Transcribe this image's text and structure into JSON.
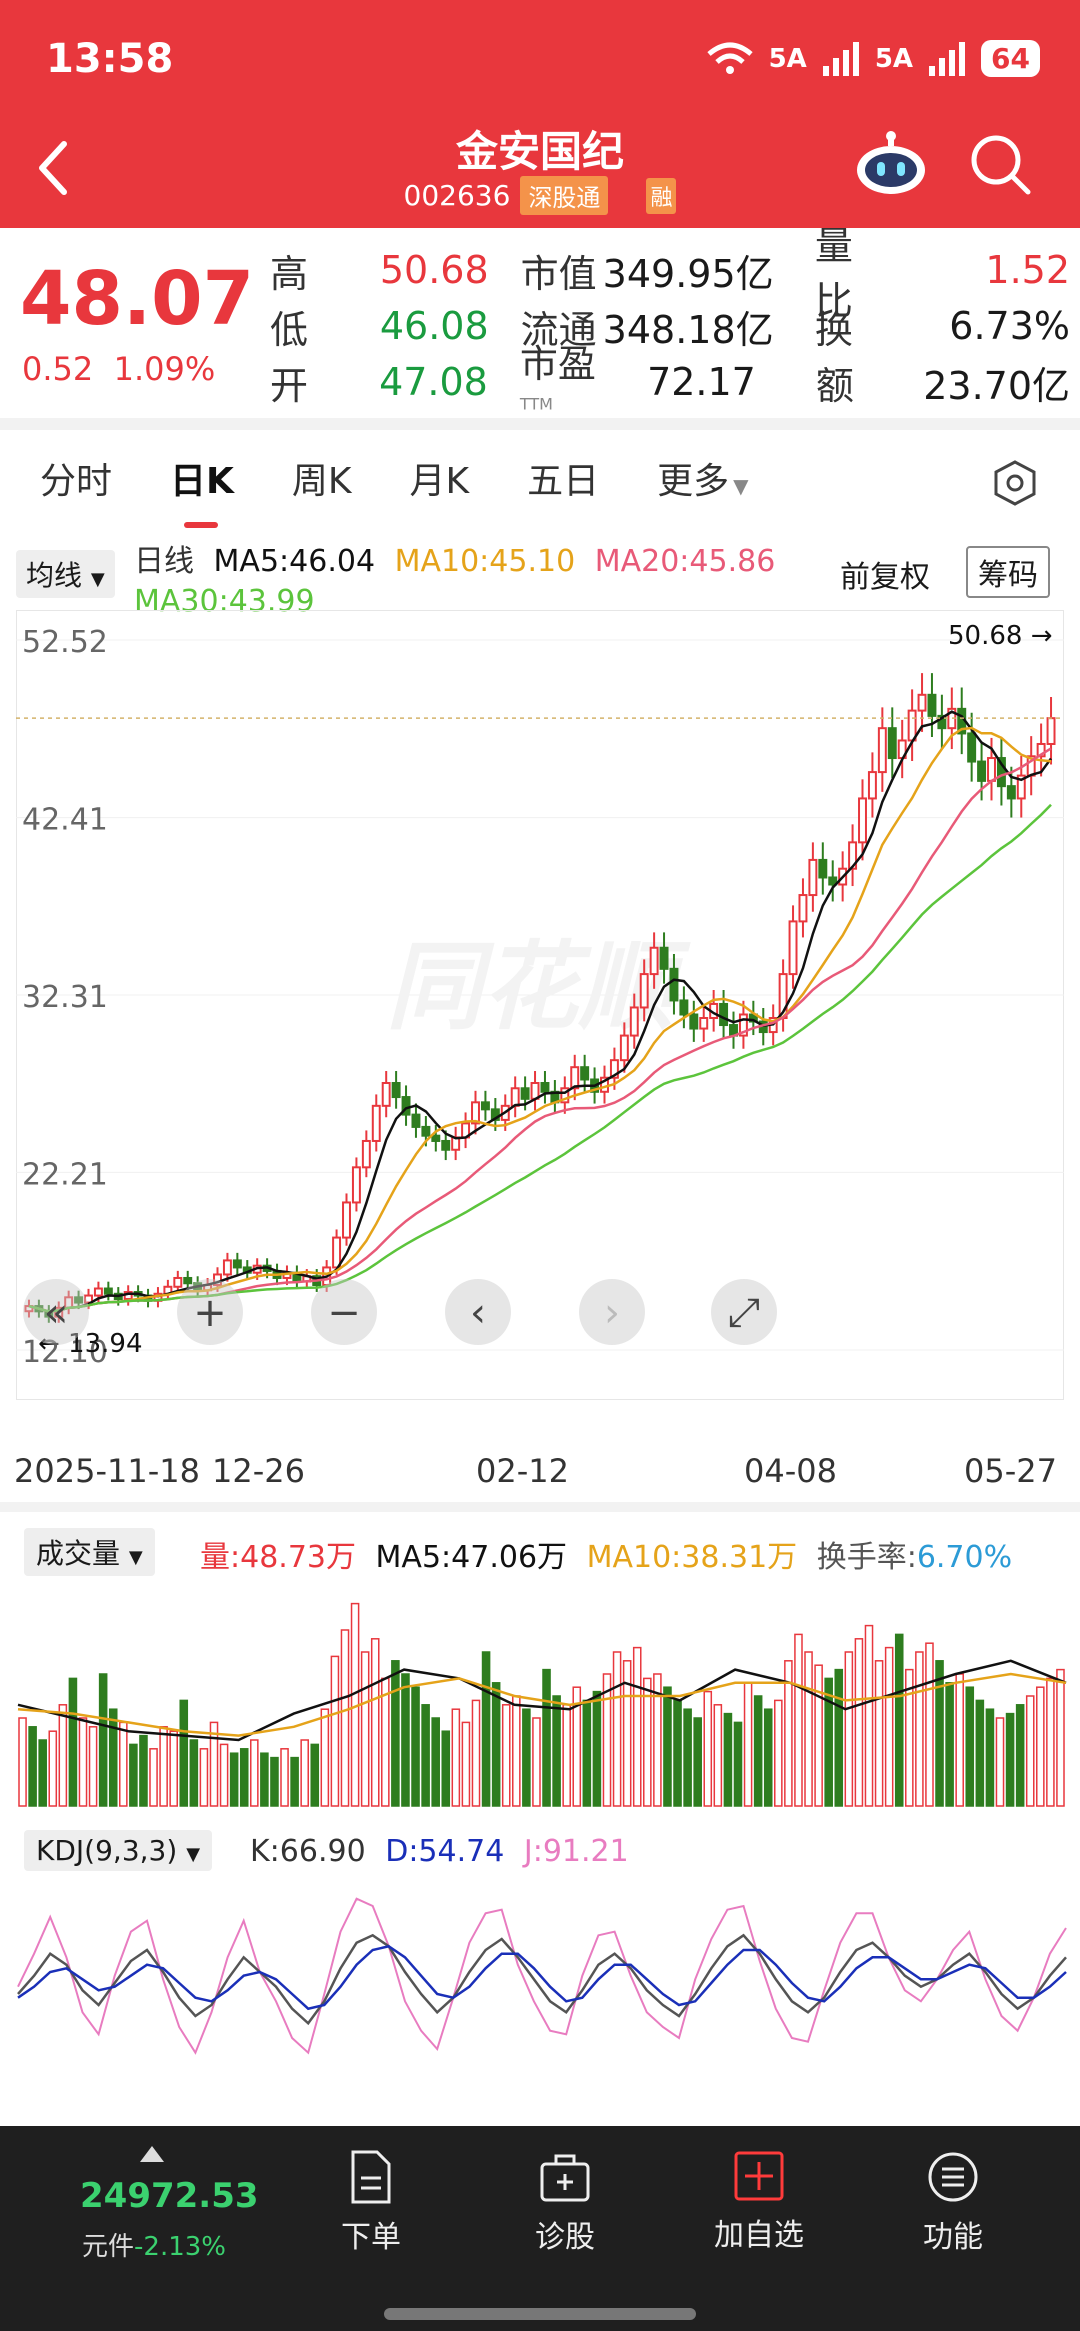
{
  "status": {
    "time": "13:58",
    "signal1": "5A",
    "signal2": "5A",
    "battery": "64"
  },
  "header": {
    "title": "金安国纪",
    "code": "002636",
    "tag": "深股通",
    "tag2": "融"
  },
  "quote": {
    "price": "48.07",
    "change": "0.52",
    "change_pct": "1.09%",
    "rows": [
      {
        "l1": "高",
        "v1": "50.68",
        "l2": "市值",
        "v2": "349.95亿",
        "l3": "量比",
        "v3": "1.52"
      },
      {
        "l1": "低",
        "v1": "46.08",
        "l2": "流通",
        "v2": "348.18亿",
        "l3": "换",
        "v3": "6.73%"
      },
      {
        "l1": "开",
        "v1": "47.08",
        "l2": "市盈",
        "l2sup": "TTM",
        "v2": "72.17",
        "l3": "额",
        "v3": "23.70亿"
      }
    ]
  },
  "tabs": [
    "分时",
    "日K",
    "周K",
    "月K",
    "五日",
    "更多"
  ],
  "ma": {
    "selector": "均线",
    "label": "日线",
    "ma5": "MA5:46.04",
    "ma10": "MA10:45.10",
    "ma20": "MA20:45.86",
    "ma30": "MA30:43.99",
    "fq": "前复权",
    "cm": "筹码"
  },
  "chart_data": {
    "type": "candlestick",
    "y_ticks": [
      "52.52",
      "42.41",
      "32.31",
      "22.21",
      "12.10"
    ],
    "ylim": [
      12.1,
      52.52
    ],
    "high_label": "50.68",
    "low_label": "13.94",
    "watermark": "同花顺",
    "x_labels": [
      "2025-11-18",
      "12-26",
      "02-12",
      "04-08",
      "05-27"
    ],
    "colors": {
      "up": "#e8373d",
      "down": "#2e7d1f",
      "ma5": "#111111",
      "ma10": "#e5a31a",
      "ma20": "#e85a78",
      "ma30": "#5cc43c"
    },
    "close_series": [
      14.6,
      14.3,
      14.0,
      14.5,
      15.1,
      14.8,
      15.2,
      15.6,
      15.3,
      15.0,
      15.4,
      15.2,
      14.9,
      15.3,
      15.7,
      16.2,
      15.9,
      15.5,
      15.8,
      16.4,
      17.2,
      16.8,
      16.5,
      16.9,
      16.6,
      16.2,
      16.5,
      16.0,
      16.3,
      15.8,
      16.8,
      18.5,
      20.5,
      22.5,
      24.0,
      26.0,
      27.3,
      26.5,
      25.5,
      24.8,
      24.3,
      24.0,
      23.5,
      24.2,
      25.0,
      26.2,
      25.8,
      25.2,
      26.0,
      27.0,
      26.4,
      27.3,
      26.8,
      26.2,
      27.0,
      28.2,
      27.5,
      26.8,
      27.6,
      28.6,
      30.0,
      31.6,
      33.5,
      35.0,
      33.8,
      32.0,
      31.2,
      30.4,
      31.0,
      31.8,
      30.6,
      30.0,
      31.2,
      30.8,
      30.2,
      31.0,
      33.5,
      36.5,
      38.0,
      40.0,
      39.0,
      38.6,
      39.5,
      41.0,
      43.5,
      45.0,
      47.5,
      45.8,
      46.8,
      48.5,
      49.4,
      48.2,
      47.5,
      48.6,
      47.2,
      45.6,
      44.5,
      45.8,
      44.2,
      43.5,
      44.8,
      45.9,
      46.6,
      48.07
    ],
    "volume_series": [
      40,
      36,
      30,
      34,
      46,
      58,
      40,
      36,
      60,
      44,
      38,
      28,
      32,
      26,
      36,
      34,
      48,
      30,
      26,
      38,
      28,
      24,
      26,
      30,
      24,
      22,
      26,
      22,
      30,
      28,
      44,
      68,
      80,
      92,
      70,
      76,
      58,
      66,
      60,
      54,
      46,
      40,
      34,
      44,
      38,
      48,
      70,
      56,
      46,
      50,
      44,
      40,
      62,
      50,
      46,
      54,
      48,
      52,
      60,
      70,
      66,
      72,
      58,
      60,
      54,
      48,
      44,
      40,
      52,
      46,
      42,
      38,
      56,
      50,
      44,
      48,
      66,
      78,
      70,
      64,
      58,
      62,
      70,
      76,
      82,
      66,
      72,
      78,
      62,
      70,
      74,
      66,
      56,
      60,
      54,
      48,
      44,
      40,
      42,
      46,
      50,
      54,
      58,
      62
    ],
    "kdj": {
      "k": [
        50,
        60,
        72,
        66,
        52,
        44,
        56,
        68,
        74,
        62,
        48,
        38,
        44,
        58,
        70,
        62,
        54,
        42,
        34,
        46,
        64,
        78,
        82,
        76,
        62,
        50,
        40,
        48,
        62,
        74,
        80,
        70,
        58,
        46,
        40,
        52,
        66,
        72,
        64,
        52,
        44,
        38,
        50,
        64,
        76,
        82,
        72,
        58,
        46,
        40,
        48,
        62,
        74,
        78,
        70,
        60,
        54,
        58,
        66,
        72,
        62,
        50,
        42,
        48,
        60,
        70
      ],
      "d": [
        48,
        54,
        62,
        64,
        58,
        52,
        54,
        60,
        66,
        64,
        56,
        48,
        46,
        52,
        60,
        62,
        58,
        50,
        42,
        44,
        54,
        66,
        74,
        76,
        70,
        60,
        50,
        48,
        54,
        64,
        72,
        72,
        64,
        54,
        46,
        48,
        58,
        66,
        66,
        58,
        50,
        44,
        46,
        56,
        66,
        74,
        74,
        66,
        56,
        48,
        46,
        54,
        64,
        70,
        70,
        64,
        58,
        58,
        62,
        66,
        64,
        56,
        48,
        48,
        54,
        62
      ]
    },
    "vol_ma5_values": [
      46,
      40,
      34,
      32,
      30,
      42,
      50,
      62,
      58,
      46,
      44,
      56,
      48,
      62,
      56,
      44,
      52,
      60,
      66,
      56
    ],
    "vol_ma10_values": [
      44,
      42,
      38,
      34,
      32,
      36,
      44,
      54,
      58,
      50,
      46,
      50,
      50,
      56,
      56,
      48,
      50,
      56,
      60,
      56
    ]
  },
  "volume": {
    "selector": "成交量",
    "vol": "量:48.73万",
    "ma5": "MA5:47.06万",
    "ma10": "MA10:38.31万",
    "turnover_label": "换手率:",
    "turnover": "6.70%"
  },
  "kdj_head": {
    "selector": "KDJ(9,3,3)",
    "k": "K:66.90",
    "d": "D:54.74",
    "j": "J:91.21"
  },
  "bottom": {
    "index_value": "24972.53",
    "index_unit": "元件",
    "index_change": "-2.13%",
    "nav": [
      "下单",
      "诊股",
      "加自选",
      "功能"
    ]
  }
}
